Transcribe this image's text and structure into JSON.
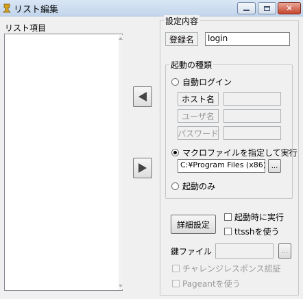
{
  "window": {
    "title": "リスト編集"
  },
  "list": {
    "label": "リスト項目"
  },
  "settings": {
    "group_label": "設定内容",
    "registration_name_label": "登録名",
    "registration_name_value": "login"
  },
  "startup": {
    "group_label": "起動の種類",
    "auto_login_label": "自動ログイン",
    "host_label": "ホスト名",
    "user_label": "ユーザ名",
    "password_label": "パスワード",
    "macro_label": "マクロファイルを指定して実行",
    "macro_path": "C:¥Program Files (x86)¥",
    "browse_label": "...",
    "launch_only_label": "起動のみ",
    "selected": "macro"
  },
  "options": {
    "detail_button": "詳細設定",
    "run_at_start_label": "起動時に実行",
    "ttssh_label": "ttsshを使う",
    "key_file_label": "鍵ファイル",
    "browse_label": "...",
    "challenge_label": "チャレンジレスポンス認証",
    "pageant_label": "Pageantを使う"
  },
  "icons": [
    "app-icon",
    "minimize-icon",
    "maximize-icon",
    "close-icon",
    "arrow-left-icon",
    "arrow-right-icon"
  ]
}
